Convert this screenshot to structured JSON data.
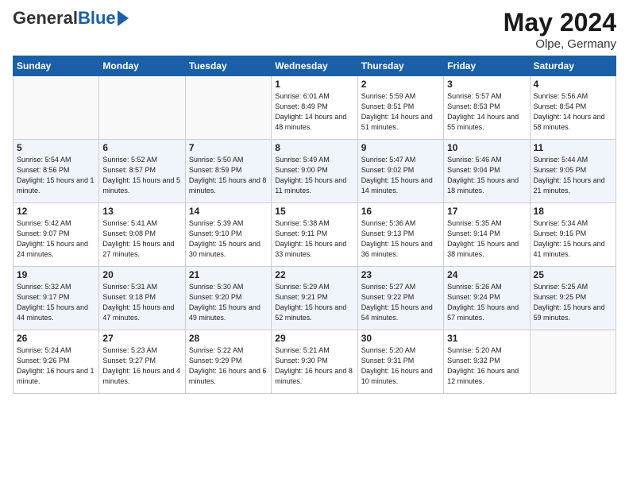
{
  "header": {
    "logo_general": "General",
    "logo_blue": "Blue",
    "tagline": "",
    "month": "May 2024",
    "location": "Olpe, Germany"
  },
  "days_of_week": [
    "Sunday",
    "Monday",
    "Tuesday",
    "Wednesday",
    "Thursday",
    "Friday",
    "Saturday"
  ],
  "weeks": [
    [
      {
        "day": "",
        "text": ""
      },
      {
        "day": "",
        "text": ""
      },
      {
        "day": "",
        "text": ""
      },
      {
        "day": "1",
        "text": "Sunrise: 6:01 AM\nSunset: 8:49 PM\nDaylight: 14 hours\nand 48 minutes."
      },
      {
        "day": "2",
        "text": "Sunrise: 5:59 AM\nSunset: 8:51 PM\nDaylight: 14 hours\nand 51 minutes."
      },
      {
        "day": "3",
        "text": "Sunrise: 5:57 AM\nSunset: 8:53 PM\nDaylight: 14 hours\nand 55 minutes."
      },
      {
        "day": "4",
        "text": "Sunrise: 5:56 AM\nSunset: 8:54 PM\nDaylight: 14 hours\nand 58 minutes."
      }
    ],
    [
      {
        "day": "5",
        "text": "Sunrise: 5:54 AM\nSunset: 8:56 PM\nDaylight: 15 hours\nand 1 minute."
      },
      {
        "day": "6",
        "text": "Sunrise: 5:52 AM\nSunset: 8:57 PM\nDaylight: 15 hours\nand 5 minutes."
      },
      {
        "day": "7",
        "text": "Sunrise: 5:50 AM\nSunset: 8:59 PM\nDaylight: 15 hours\nand 8 minutes."
      },
      {
        "day": "8",
        "text": "Sunrise: 5:49 AM\nSunset: 9:00 PM\nDaylight: 15 hours\nand 11 minutes."
      },
      {
        "day": "9",
        "text": "Sunrise: 5:47 AM\nSunset: 9:02 PM\nDaylight: 15 hours\nand 14 minutes."
      },
      {
        "day": "10",
        "text": "Sunrise: 5:46 AM\nSunset: 9:04 PM\nDaylight: 15 hours\nand 18 minutes."
      },
      {
        "day": "11",
        "text": "Sunrise: 5:44 AM\nSunset: 9:05 PM\nDaylight: 15 hours\nand 21 minutes."
      }
    ],
    [
      {
        "day": "12",
        "text": "Sunrise: 5:42 AM\nSunset: 9:07 PM\nDaylight: 15 hours\nand 24 minutes."
      },
      {
        "day": "13",
        "text": "Sunrise: 5:41 AM\nSunset: 9:08 PM\nDaylight: 15 hours\nand 27 minutes."
      },
      {
        "day": "14",
        "text": "Sunrise: 5:39 AM\nSunset: 9:10 PM\nDaylight: 15 hours\nand 30 minutes."
      },
      {
        "day": "15",
        "text": "Sunrise: 5:38 AM\nSunset: 9:11 PM\nDaylight: 15 hours\nand 33 minutes."
      },
      {
        "day": "16",
        "text": "Sunrise: 5:36 AM\nSunset: 9:13 PM\nDaylight: 15 hours\nand 36 minutes."
      },
      {
        "day": "17",
        "text": "Sunrise: 5:35 AM\nSunset: 9:14 PM\nDaylight: 15 hours\nand 38 minutes."
      },
      {
        "day": "18",
        "text": "Sunrise: 5:34 AM\nSunset: 9:15 PM\nDaylight: 15 hours\nand 41 minutes."
      }
    ],
    [
      {
        "day": "19",
        "text": "Sunrise: 5:32 AM\nSunset: 9:17 PM\nDaylight: 15 hours\nand 44 minutes."
      },
      {
        "day": "20",
        "text": "Sunrise: 5:31 AM\nSunset: 9:18 PM\nDaylight: 15 hours\nand 47 minutes."
      },
      {
        "day": "21",
        "text": "Sunrise: 5:30 AM\nSunset: 9:20 PM\nDaylight: 15 hours\nand 49 minutes."
      },
      {
        "day": "22",
        "text": "Sunrise: 5:29 AM\nSunset: 9:21 PM\nDaylight: 15 hours\nand 52 minutes."
      },
      {
        "day": "23",
        "text": "Sunrise: 5:27 AM\nSunset: 9:22 PM\nDaylight: 15 hours\nand 54 minutes."
      },
      {
        "day": "24",
        "text": "Sunrise: 5:26 AM\nSunset: 9:24 PM\nDaylight: 15 hours\nand 57 minutes."
      },
      {
        "day": "25",
        "text": "Sunrise: 5:25 AM\nSunset: 9:25 PM\nDaylight: 15 hours\nand 59 minutes."
      }
    ],
    [
      {
        "day": "26",
        "text": "Sunrise: 5:24 AM\nSunset: 9:26 PM\nDaylight: 16 hours\nand 1 minute."
      },
      {
        "day": "27",
        "text": "Sunrise: 5:23 AM\nSunset: 9:27 PM\nDaylight: 16 hours\nand 4 minutes."
      },
      {
        "day": "28",
        "text": "Sunrise: 5:22 AM\nSunset: 9:29 PM\nDaylight: 16 hours\nand 6 minutes."
      },
      {
        "day": "29",
        "text": "Sunrise: 5:21 AM\nSunset: 9:30 PM\nDaylight: 16 hours\nand 8 minutes."
      },
      {
        "day": "30",
        "text": "Sunrise: 5:20 AM\nSunset: 9:31 PM\nDaylight: 16 hours\nand 10 minutes."
      },
      {
        "day": "31",
        "text": "Sunrise: 5:20 AM\nSunset: 9:32 PM\nDaylight: 16 hours\nand 12 minutes."
      },
      {
        "day": "",
        "text": ""
      }
    ]
  ]
}
